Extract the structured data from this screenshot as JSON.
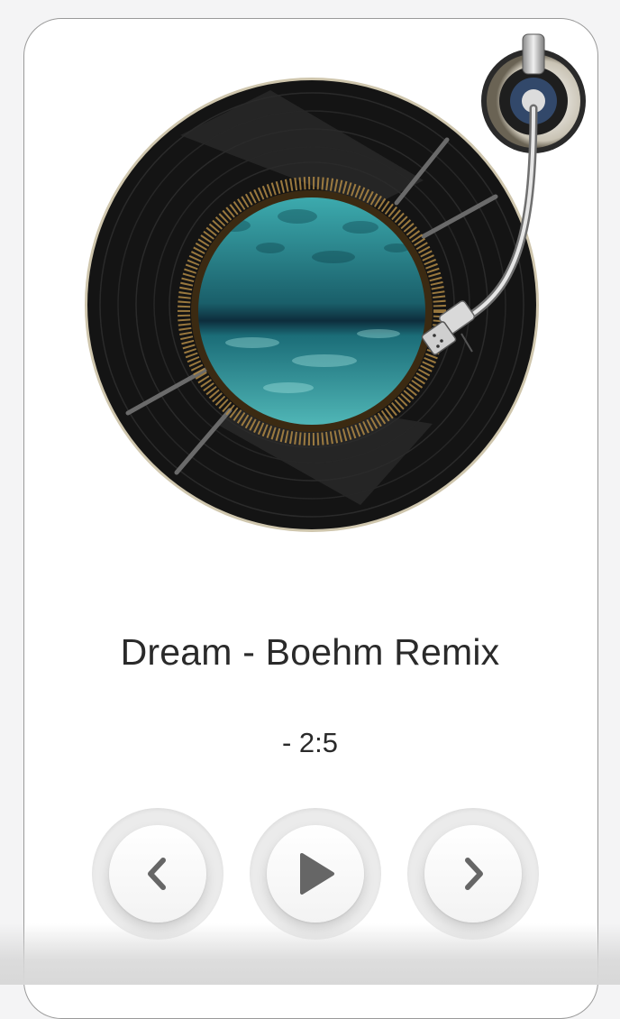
{
  "player": {
    "track_title": "Dream - Boehm Remix",
    "time_remaining": "- 2:5"
  },
  "controls": {
    "previous": "previous",
    "play": "play",
    "next": "next"
  },
  "colors": {
    "record": "#141414",
    "water": "#2fa3a6",
    "gold": "#c89a4a",
    "icon": "#666666"
  }
}
